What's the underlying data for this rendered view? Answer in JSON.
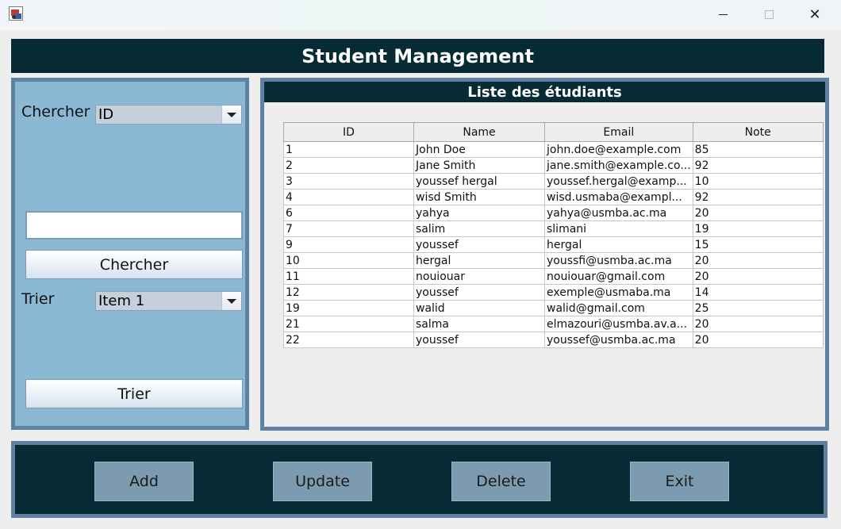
{
  "window": {
    "minimize_icon": "minimize-icon",
    "maximize_icon": "maximize-icon",
    "close_glyph": "✕"
  },
  "header": {
    "title": "Student Management"
  },
  "search": {
    "label": "Chercher",
    "combo_value": "ID",
    "input_value": "",
    "button_label": "Chercher"
  },
  "sort": {
    "label": "Trier",
    "combo_value": "Item 1",
    "button_label": "Trier"
  },
  "list": {
    "title": "Liste des étudiants",
    "columns": [
      "ID",
      "Name",
      "Email",
      "Note"
    ],
    "rows": [
      [
        "1",
        "John Doe",
        "john.doe@example.com",
        "85"
      ],
      [
        "2",
        "Jane Smith",
        "jane.smith@example.co...",
        "92"
      ],
      [
        "3",
        "youssef hergal",
        "youssef.hergal@examp...",
        "10"
      ],
      [
        "4",
        "wisd Smith",
        "wisd.usmaba@exampl...",
        "92"
      ],
      [
        "6",
        "yahya",
        "yahya@usmba.ac.ma",
        "20"
      ],
      [
        "7",
        "salim",
        "slimani",
        "19"
      ],
      [
        "9",
        "youssef",
        "hergal",
        "15"
      ],
      [
        "10",
        "hergal",
        "youssfi@usmba.ac.ma",
        "20"
      ],
      [
        "11",
        "nouiouar",
        "nouiouar@gmail.com",
        "20"
      ],
      [
        "12",
        "youssef",
        "exemple@usmaba.ma",
        "14"
      ],
      [
        "19",
        "walid",
        "walid@gmail.com",
        "25"
      ],
      [
        "21",
        "salma",
        "elmazouri@usmba.av.a...",
        "20"
      ],
      [
        "22",
        "youssef",
        "youssef@usmba.ac.ma",
        "20"
      ]
    ]
  },
  "actions": {
    "add": "Add",
    "update": "Update",
    "delete": "Delete",
    "exit": "Exit"
  },
  "colors": {
    "dark_teal": "#072b35",
    "panel_blue": "#8bb9d4",
    "border_blue": "#5f82a2",
    "action_button": "#7d9bb0"
  }
}
